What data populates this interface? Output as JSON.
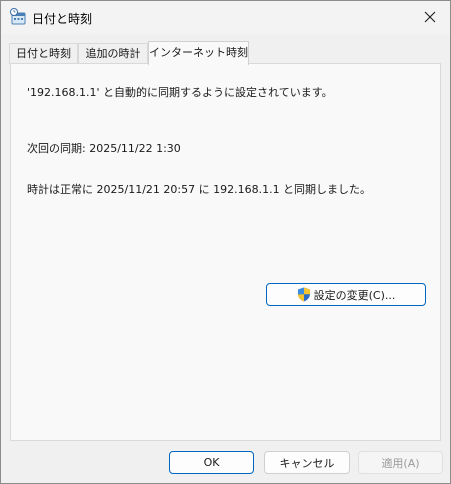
{
  "window": {
    "title": "日付と時刻",
    "icon": "clock-calendar-icon",
    "close_icon": "close-icon"
  },
  "tabs": [
    {
      "label": "日付と時刻",
      "active": false
    },
    {
      "label": "追加の時計",
      "active": false
    },
    {
      "label": "インターネット時刻",
      "active": true
    }
  ],
  "panel": {
    "sync_config": "'192.168.1.1' と自動的に同期するように設定されています。",
    "next_sync": "次回の同期: 2025/11/22 1:30",
    "last_sync": "時計は正常に 2025/11/21 20:57 に 192.168.1.1 と同期しました。",
    "change_settings_label": "設定の変更(C)...",
    "change_settings_icon": "uac-shield-icon"
  },
  "footer": {
    "ok_label": "OK",
    "cancel_label": "キャンセル",
    "apply_label": "適用(A)",
    "apply_enabled": false
  },
  "colors": {
    "accent": "#0067c0",
    "panel_bg": "#f9f9f9",
    "window_bg": "#f0f0f0"
  }
}
